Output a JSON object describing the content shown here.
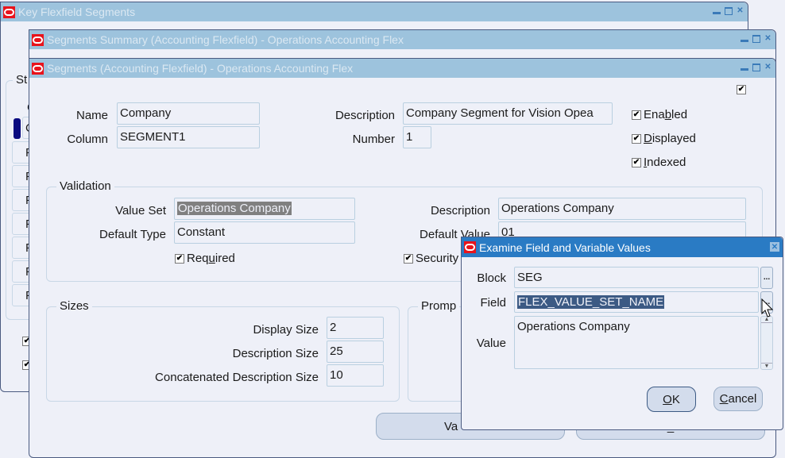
{
  "windows": {
    "key_flexfield": {
      "title": "Key Flexfield Segments",
      "structure_label_partial": "St",
      "list_header_partial": "C",
      "list_rows": [
        "C",
        "F",
        "F",
        "F",
        "F",
        "F",
        "F",
        "F"
      ],
      "checkboxes": [
        {
          "checked": true
        },
        {
          "checked": true
        }
      ]
    },
    "segments_summary": {
      "title": "Segments Summary (Accounting Flexfield) - Operations Accounting Flex"
    },
    "segments": {
      "title": "Segments (Accounting Flexfield) - Operations Accounting Flex",
      "top_checkbox_checked": true,
      "name_label": "Name",
      "name_value": "Company",
      "column_label": "Column",
      "column_value": "SEGMENT1",
      "description_label": "Description",
      "description_value": "Company Segment for Vision Opea",
      "number_label": "Number",
      "number_value": "1",
      "enabled": {
        "label_pre": "Ena",
        "label_u": "b",
        "label_post": "led",
        "checked": true
      },
      "displayed": {
        "label_pre": "",
        "label_u": "D",
        "label_post": "isplayed",
        "checked": true
      },
      "indexed": {
        "label_pre": "",
        "label_u": "I",
        "label_post": "ndexed",
        "checked": true
      },
      "validation": {
        "legend": "Validation",
        "value_set_label": "Value Set",
        "value_set_value": "Operations Company",
        "default_type_label": "Default Type",
        "default_type_value": "Constant",
        "required": {
          "label_pre": "Req",
          "label_u": "u",
          "label_post": "ired",
          "checked": true
        },
        "description_label": "Description",
        "description_value": "Operations Company",
        "default_value_label": "Default Value",
        "default_value_value": "01",
        "security": {
          "label": "Security",
          "checked": true
        }
      },
      "sizes": {
        "legend": "Sizes",
        "display_size_label": "Display Size",
        "display_size_value": "2",
        "description_size_label": "Description Size",
        "description_size_value": "25",
        "concat_size_label": "Concatenated Description Size",
        "concat_size_value": "10"
      },
      "prompts": {
        "legend_partial": "Promp"
      },
      "buttons": {
        "value_set_partial": "Va",
        "right_partial": "_"
      }
    },
    "examine": {
      "title": "Examine Field and Variable Values",
      "block_label": "Block",
      "block_value": "SEG",
      "field_label": "Field",
      "field_value": "FLEX_VALUE_SET_NAME",
      "value_label": "Value",
      "value_value": "Operations Company",
      "lov_glyph": "...",
      "ok_u": "O",
      "ok_rest": "K",
      "cancel_u": "C",
      "cancel_rest": "ancel"
    }
  },
  "icons": {
    "close": "✕",
    "check": "✔",
    "scroll_up": "▲",
    "scroll_down": "▼"
  }
}
